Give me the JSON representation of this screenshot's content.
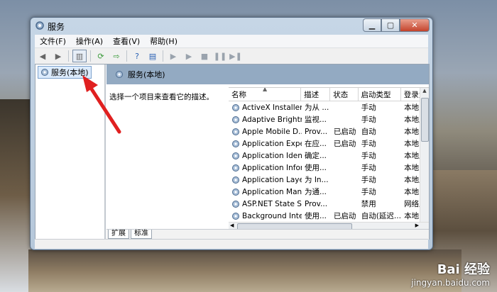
{
  "window": {
    "title": "服务"
  },
  "menu": {
    "items": [
      "文件(F)",
      "操作(A)",
      "查看(V)",
      "帮助(H)"
    ]
  },
  "tree": {
    "node_label": "服务(本地)"
  },
  "panel": {
    "header_label": "服务(本地)",
    "description": "选择一个项目来查看它的描述。"
  },
  "list": {
    "columns": [
      "名称",
      "描述",
      "状态",
      "启动类型",
      "登录为"
    ],
    "rows": [
      {
        "name": "ActiveX Installer ...",
        "desc": "为从 ...",
        "status": "",
        "startup": "手动",
        "logon": "本地系"
      },
      {
        "name": "Adaptive Brightn...",
        "desc": "监视...",
        "status": "",
        "startup": "手动",
        "logon": "本地服"
      },
      {
        "name": "Apple Mobile D...",
        "desc": "Prov...",
        "status": "已启动",
        "startup": "自动",
        "logon": "本地系"
      },
      {
        "name": "Application Expe...",
        "desc": "在应...",
        "status": "已启动",
        "startup": "手动",
        "logon": "本地系"
      },
      {
        "name": "Application Iden...",
        "desc": "确定...",
        "status": "",
        "startup": "手动",
        "logon": "本地服"
      },
      {
        "name": "Application Infor...",
        "desc": "使用...",
        "status": "",
        "startup": "手动",
        "logon": "本地系"
      },
      {
        "name": "Application Laye...",
        "desc": "为 In...",
        "status": "",
        "startup": "手动",
        "logon": "本地服"
      },
      {
        "name": "Application Man...",
        "desc": "为通...",
        "status": "",
        "startup": "手动",
        "logon": "本地系"
      },
      {
        "name": "ASP.NET State S...",
        "desc": "Prov...",
        "status": "",
        "startup": "禁用",
        "logon": "网络服"
      },
      {
        "name": "Background Inte...",
        "desc": "使用...",
        "status": "已启动",
        "startup": "自动(延迟...",
        "logon": "本地系"
      }
    ]
  },
  "tabs": {
    "items": [
      "扩展",
      "标准"
    ]
  },
  "watermark": {
    "logo": "Bai 经验",
    "url": "jingyan.baidu.com"
  },
  "colors": {
    "annotation_arrow": "#e02020",
    "panel_header": "#93aac2"
  }
}
